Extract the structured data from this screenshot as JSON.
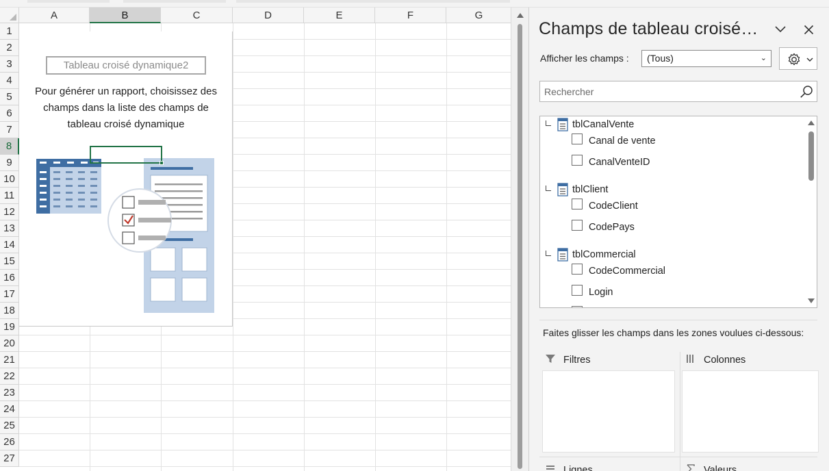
{
  "sheet": {
    "columns": [
      "A",
      "B",
      "C",
      "D",
      "E",
      "F",
      "G"
    ],
    "selected_column": "B",
    "rows": [
      "1",
      "2",
      "3",
      "4",
      "5",
      "6",
      "7",
      "8",
      "9",
      "10",
      "11",
      "12",
      "13",
      "14",
      "15",
      "16",
      "17",
      "18",
      "19",
      "20",
      "21",
      "22",
      "23",
      "24",
      "25",
      "26",
      "27"
    ],
    "selected_row": "8"
  },
  "pivot_placeholder": {
    "name": "Tableau croisé dynamique2",
    "message_lines": [
      "Pour générer un rapport, choisissez des",
      "champs dans la liste des champs de",
      "tableau croisé dynamique"
    ]
  },
  "pane": {
    "title": "Champs de tableau croisé…",
    "show_fields_label": "Afficher les champs :",
    "show_fields_value": "(Tous)",
    "search_placeholder": "Rechercher",
    "tables": [
      {
        "name": "tblCanalVente",
        "fields": [
          "Canal de vente",
          "CanalVenteID"
        ]
      },
      {
        "name": "tblClient",
        "fields": [
          "CodeClient",
          "CodePays"
        ]
      },
      {
        "name": "tblCommercial",
        "fields": [
          "CodeCommercial",
          "Login"
        ]
      }
    ],
    "drag_hint": "Faites glisser les champs dans les zones voulues ci-dessous:",
    "zones": {
      "filters": "Filtres",
      "columns": "Colonnes",
      "rows": "Lignes",
      "values": "Valeurs"
    }
  },
  "colors": {
    "excel_green": "#217346",
    "pane_bg": "#f3f3f3",
    "illustration_blue": "#3f6ea3",
    "illustration_light": "#c2d3e8",
    "check_red": "#c0392b"
  },
  "icons": [
    "chevron-down-icon",
    "close-icon",
    "gear-icon",
    "search-icon",
    "table-icon",
    "filter-icon",
    "columns-icon",
    "rows-icon",
    "sigma-icon"
  ]
}
